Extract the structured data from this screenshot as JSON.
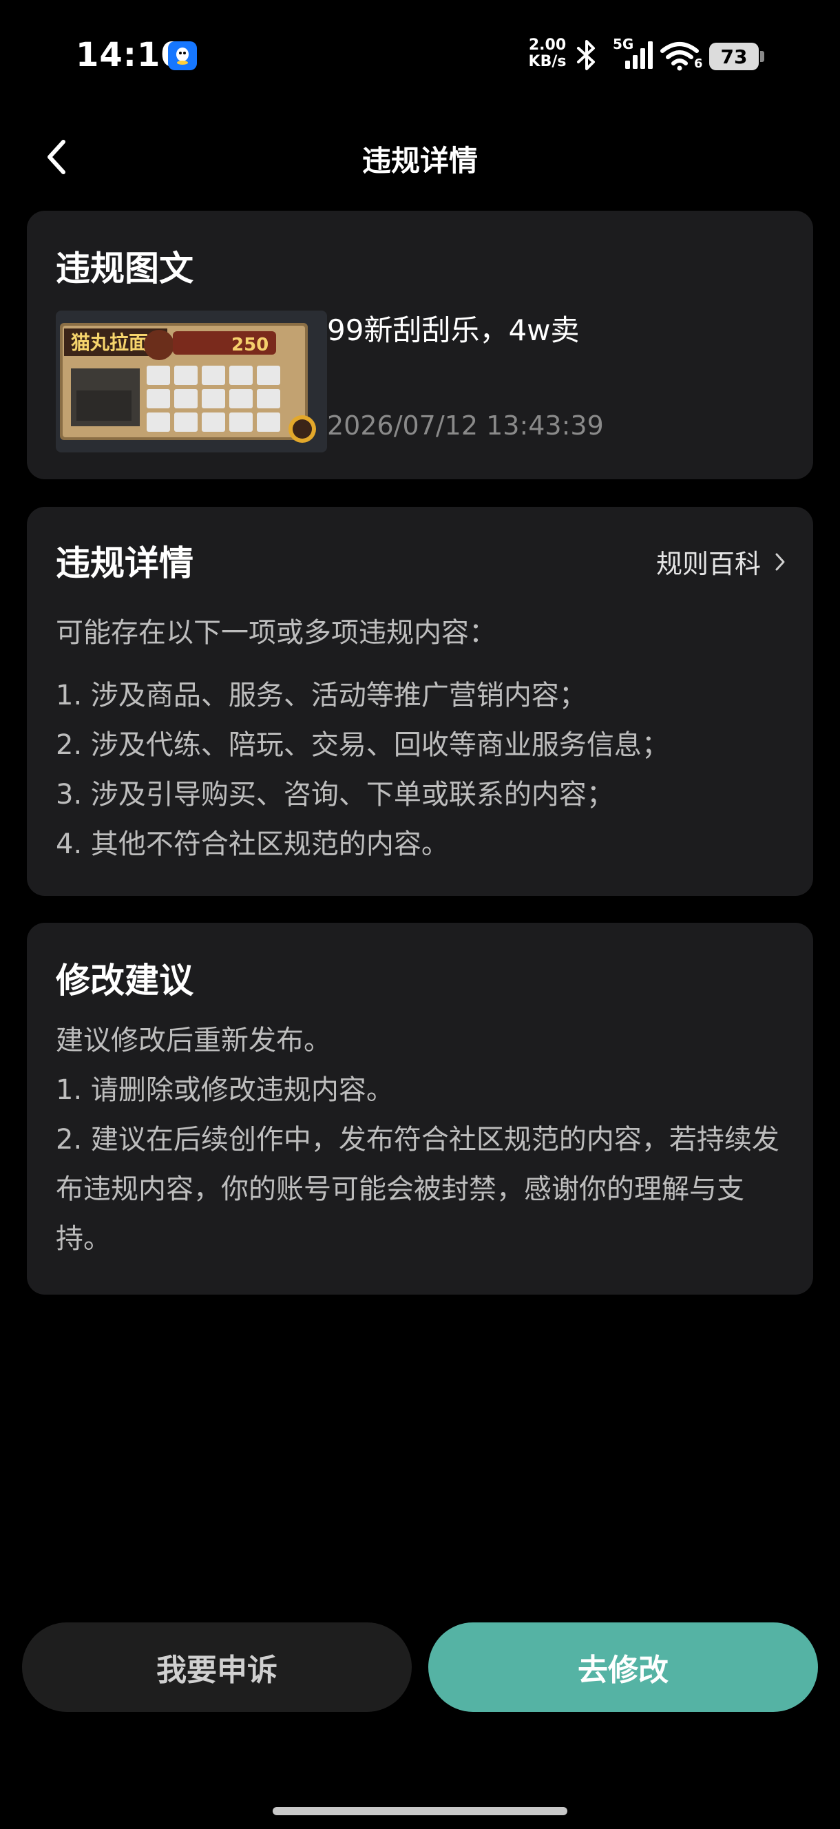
{
  "status_bar": {
    "time": "14:10",
    "net_speed_value": "2.00",
    "net_speed_unit": "KB/s",
    "network_type": "5G",
    "wifi_label": "6",
    "battery": "73",
    "icons": [
      "qq-app-icon",
      "bluetooth-icon",
      "signal-icon",
      "wifi-icon",
      "battery-icon"
    ]
  },
  "nav": {
    "title": "违规详情",
    "back_icon": "chevron-left-icon"
  },
  "post_card": {
    "title": "违规图文",
    "post_title": "99新刮刮乐，4w卖",
    "post_time": "2026/07/12 13:43:39",
    "thumbnail_text": "猫丸拉面",
    "thumbnail_prize": "250"
  },
  "detail_card": {
    "title": "违规详情",
    "rules_link": "规则百科",
    "intro": "可能存在以下一项或多项违规内容：",
    "items": [
      "1. 涉及商品、服务、活动等推广营销内容；",
      "2. 涉及代练、陪玩、交易、回收等商业服务信息；",
      "3. 涉及引导购买、咨询、下单或联系的内容；",
      "4. 其他不符合社区规范的内容。"
    ]
  },
  "advice_card": {
    "title": "修改建议",
    "lines": [
      "建议修改后重新发布。",
      "1. 请删除或修改违规内容。",
      "2. 建议在后续创作中，发布符合社区规范的内容，若持续发布违规内容，你的账号可能会被封禁，感谢你的理解与支持。"
    ]
  },
  "actions": {
    "appeal": "我要申诉",
    "edit": "去修改"
  },
  "colors": {
    "background": "#000000",
    "card": "#1c1c1e",
    "primary_button": "#55b3a4",
    "secondary_button": "#1e1e1e",
    "muted_text": "#8a8a8a"
  }
}
